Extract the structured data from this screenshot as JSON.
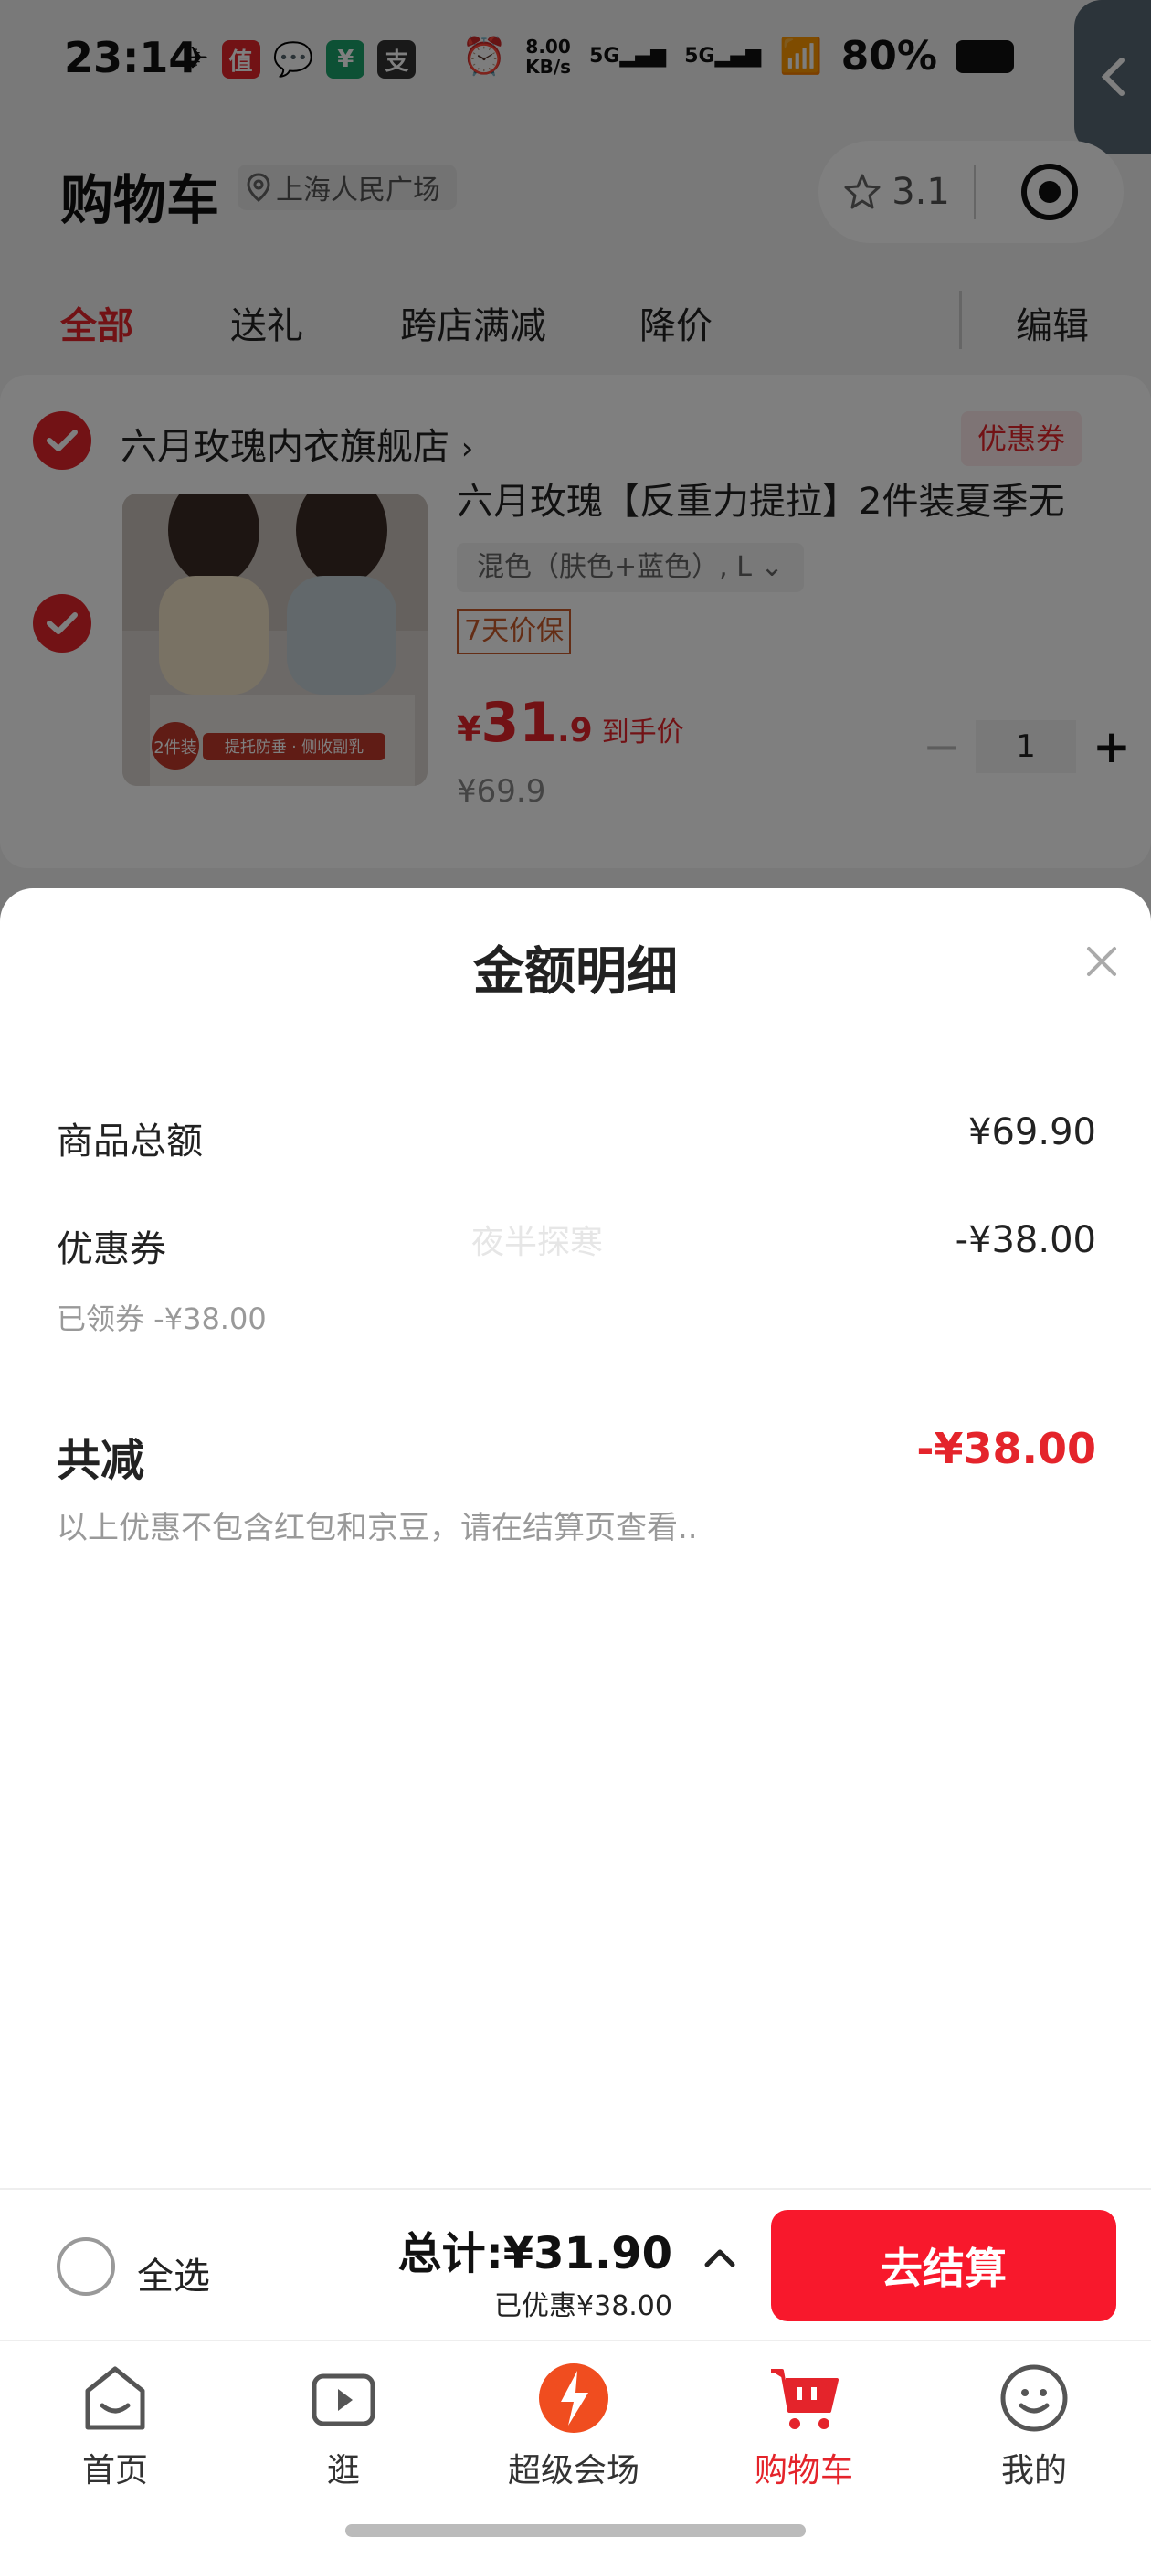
{
  "status_bar": {
    "time": "23:14",
    "net_speed_top": "8.00",
    "net_speed_bottom": "KB/s",
    "sig1": "5G",
    "sig2": "5G",
    "battery": "80%"
  },
  "header": {
    "title": "购物车",
    "location": "上海人民广场",
    "capsule_rating": "3.1"
  },
  "tabs": {
    "all": "全部",
    "gift": "送礼",
    "cross_store": "跨店满减",
    "price_drop": "降价",
    "edit": "编辑"
  },
  "store": {
    "name": "六月玫瑰内衣旗舰店",
    "coupon_tag": "优惠券",
    "product": {
      "title": "六月玫瑰【反重力提拉】2件装夏季无",
      "spec": "混色（肤色+蓝色）, L",
      "guarantee": "7天价保",
      "price_yen": "¥",
      "price_int": "31",
      "price_dec": ".9",
      "price_label": "到手价",
      "original_price": "¥69.9",
      "quantity": "1",
      "image_badge": "2件装",
      "image_caption": "提托防垂 · 侧收副乳"
    }
  },
  "sheet": {
    "title": "金额明细",
    "watermark": "夜半探寒",
    "rows": {
      "goods_total_label": "商品总额",
      "goods_total_value": "¥69.90",
      "coupon_label": "优惠券",
      "coupon_value": "-¥38.00",
      "coupon_sub": "已领券 -¥38.00",
      "total_discount_label": "共减",
      "total_discount_value": "-¥38.00",
      "note": "以上优惠不包含红包和京豆，请在结算页查看.."
    }
  },
  "checkout": {
    "select_all": "全选",
    "total_prefix": "总计:",
    "total_amount": "¥31.90",
    "discount": "已优惠¥38.00",
    "button": "去结算"
  },
  "nav": {
    "home": "首页",
    "browse": "逛",
    "super": "超级会场",
    "cart": "购物车",
    "mine": "我的"
  },
  "colors": {
    "accent_red": "#e4242b",
    "checkout_red": "#f8182c"
  }
}
